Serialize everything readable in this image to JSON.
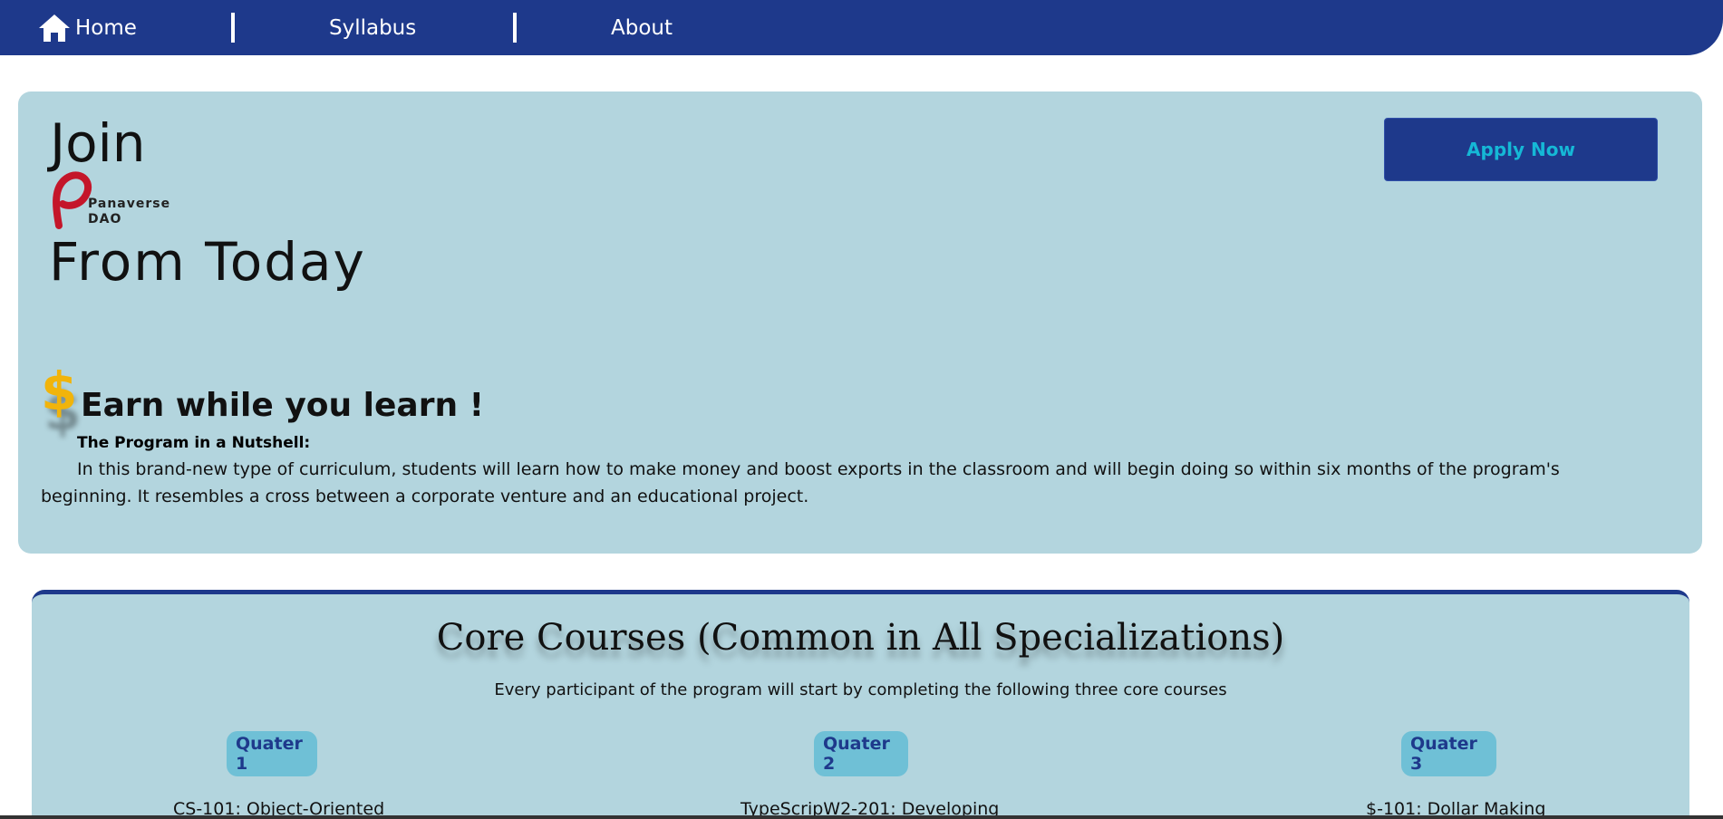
{
  "nav": {
    "home_label": "Home",
    "syllabus_label": "Syllabus",
    "about_label": "About",
    "bg_color": "#1e398b"
  },
  "hero": {
    "join_text": "Join",
    "logo_line1": "Panaverse",
    "logo_line2": "DAO",
    "from_today": "From Today",
    "apply_label": "Apply Now",
    "earn_heading": "Earn while you learn !",
    "dollar_symbol": "$",
    "nutshell_title": "The Program in a Nutshell:",
    "nutshell_body": "In this brand-new type of curriculum, students will learn how to make money and boost exports in the classroom and will begin doing so within six months of the program's beginning. It resembles a cross between a corporate venture and an educational project.",
    "bg_color": "#b3d5de"
  },
  "core": {
    "title": "Core Courses (Common in All Specializations)",
    "subtitle": "Every participant of the program will start by completing the following three core courses",
    "quarters": [
      {
        "label": "Quater 1",
        "course": "CS-101: Object-Oriented"
      },
      {
        "label": "Quater 2",
        "course": "TypeScripW2-201: Developing"
      },
      {
        "label": "Quater 3",
        "course": "$-101: Dollar Making"
      }
    ]
  }
}
